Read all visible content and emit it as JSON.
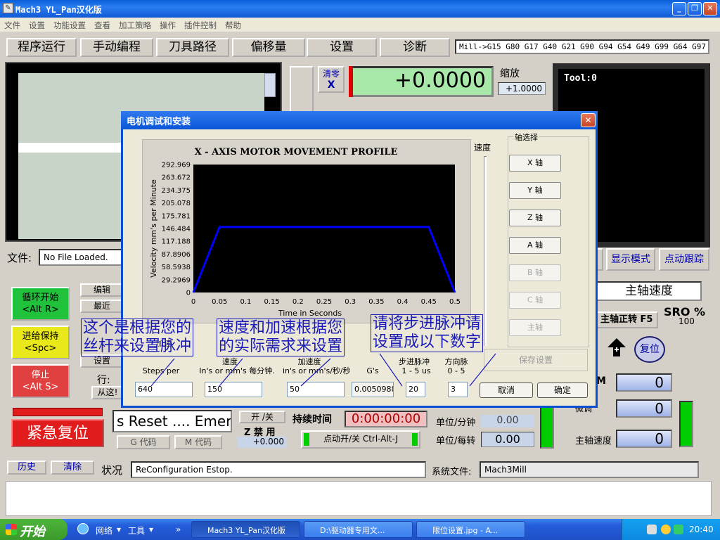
{
  "window": {
    "title": "Mach3 YL_Pan汉化版"
  },
  "menu": [
    "文件",
    "设置",
    "功能设置",
    "查看",
    "加工策略",
    "操作",
    "插件控制",
    "帮助"
  ],
  "tabs": [
    "程序运行",
    "手动编程",
    "刀具路径",
    "偏移量",
    "设置",
    "诊断"
  ],
  "gcode_modal": "Mill->G15  G80 G17 G40 G21 G90 G94 G54 G49 G99 G64 G97",
  "dro": {
    "zero_x_label": "清零",
    "zero_x_axis": "X",
    "x_value": "+0.0000",
    "scale_label": "缩放",
    "scale_value": "+1.0000"
  },
  "tool_display": "Tool:0",
  "file": {
    "label": "文件:",
    "value": "No File Loaded."
  },
  "left_buttons": {
    "cycle_start": "循环开始",
    "cycle_start_key": "<Alt R>",
    "feed_hold": "进给保持",
    "feed_hold_key": "<Spc>",
    "stop": "停止",
    "stop_key": "<Alt S>",
    "edit": "编辑",
    "recent": "最近",
    "load": "加载",
    "set": "设置",
    "line_label": "行:",
    "from_here": "从这!"
  },
  "right_panel": {
    "display_mode": "显示模式",
    "jog_follow": "点动跟踪",
    "spindle_speed_title": "主轴速度",
    "sro": "SRO %",
    "sro_value": "100",
    "spindle_fwd": "主轴正转 F5",
    "reset": "复位",
    "m_label": "M",
    "field1": "0",
    "override_label": "微调",
    "field2": "0",
    "spindle_speed_label": "主轴速度",
    "field3": "0"
  },
  "lower": {
    "estop": "紧急复位",
    "status_scroll": "s Reset .... Emerg",
    "gcode_btn": "G 代码",
    "mcode_btn": "M 代码",
    "onoff": "开 /关",
    "z_forbid": "Z 禁 用",
    "z_value": "+0.000",
    "runtime_label": "持续时间",
    "runtime_value": "0:00:00:00",
    "jog_btn": "点动开/关 Ctrl-Alt-J",
    "units_per_min_label": "单位/分钟",
    "units_per_min_value": "0.00",
    "units_per_rev_label": "单位/每转",
    "units_per_rev_value": "0.00"
  },
  "status_bar": {
    "history": "历史",
    "clear": "清除",
    "status_label": "状况",
    "status_value": "ReConfiguration Estop.",
    "sysfile_label": "系统文件:",
    "sysfile_value": "Mach3Mill"
  },
  "dialog": {
    "title": "电机调试和安装",
    "velocity_label": "速度",
    "axis_group": "轴选择",
    "axis_buttons": [
      {
        "label": "X 轴",
        "enabled": true
      },
      {
        "label": "Y 轴",
        "enabled": true
      },
      {
        "label": "Z 轴",
        "enabled": true
      },
      {
        "label": "A 轴",
        "enabled": true
      },
      {
        "label": "B 轴",
        "enabled": false
      },
      {
        "label": "C 轴",
        "enabled": false
      },
      {
        "label": "主轴",
        "enabled": false
      }
    ],
    "save": "保存设置",
    "cancel": "取消",
    "ok": "确定",
    "fields": {
      "steps_label": "Steps per",
      "steps_value": "640",
      "velocity_label_en": "In's or mm's 每分钟.",
      "velocity_label_cn": "速度",
      "velocity_value": "150",
      "accel_label_cn": "加速度",
      "accel_label_en": "in's or mm's/秒/秒",
      "accel_value": "50",
      "gs_label": "G's",
      "gs_value": "0.0050988",
      "step_pulse_label": "步进脉冲",
      "step_pulse_range": "1 - 5 us",
      "step_pulse_value": "20",
      "dir_pulse_label": "方向脉",
      "dir_pulse_range": "0 - 5",
      "dir_pulse_value": "3",
      "accel_overlap": "加速"
    }
  },
  "chart_data": {
    "type": "line",
    "title": "X - AXIS MOTOR MOVEMENT PROFILE",
    "xlabel": "Time in Seconds",
    "ylabel": "Velocity mm's per Minute",
    "xlim": [
      0,
      0.5
    ],
    "ylim": [
      0,
      292.969
    ],
    "x_ticks": [
      "0",
      "0.05",
      "0.1",
      "0.15",
      "0.2",
      "0.25",
      "0.3",
      "0.35",
      "0.4",
      "0.45",
      "0.5"
    ],
    "y_ticks": [
      "292.969",
      "263.672",
      "234.375",
      "205.078",
      "175.781",
      "146.484",
      "117.188",
      "87.8906",
      "58.5938",
      "29.2969",
      "0"
    ],
    "grid": false,
    "series": [
      {
        "color": "#0000ff",
        "x": [
          0,
          0.05,
          0.45,
          0.5
        ],
        "y": [
          0,
          150,
          150,
          0
        ]
      }
    ]
  },
  "annotations": {
    "a1_line1": "这个是根据您的",
    "a1_line2": "丝杆来设置脉冲",
    "a2_line1": "速度和加速根据您",
    "a2_line2": "的实际需求来设置",
    "a3_line1": "请将步进脉冲请",
    "a3_line2": "设置成以下数字"
  },
  "taskbar": {
    "start": "开始",
    "network": "网络",
    "tools": "工具",
    "items": [
      "Mach3 YL_Pan汉化版",
      "D:\\驱动器专用文...",
      "限位设置.jpg - A..."
    ],
    "clock": "20:40"
  }
}
